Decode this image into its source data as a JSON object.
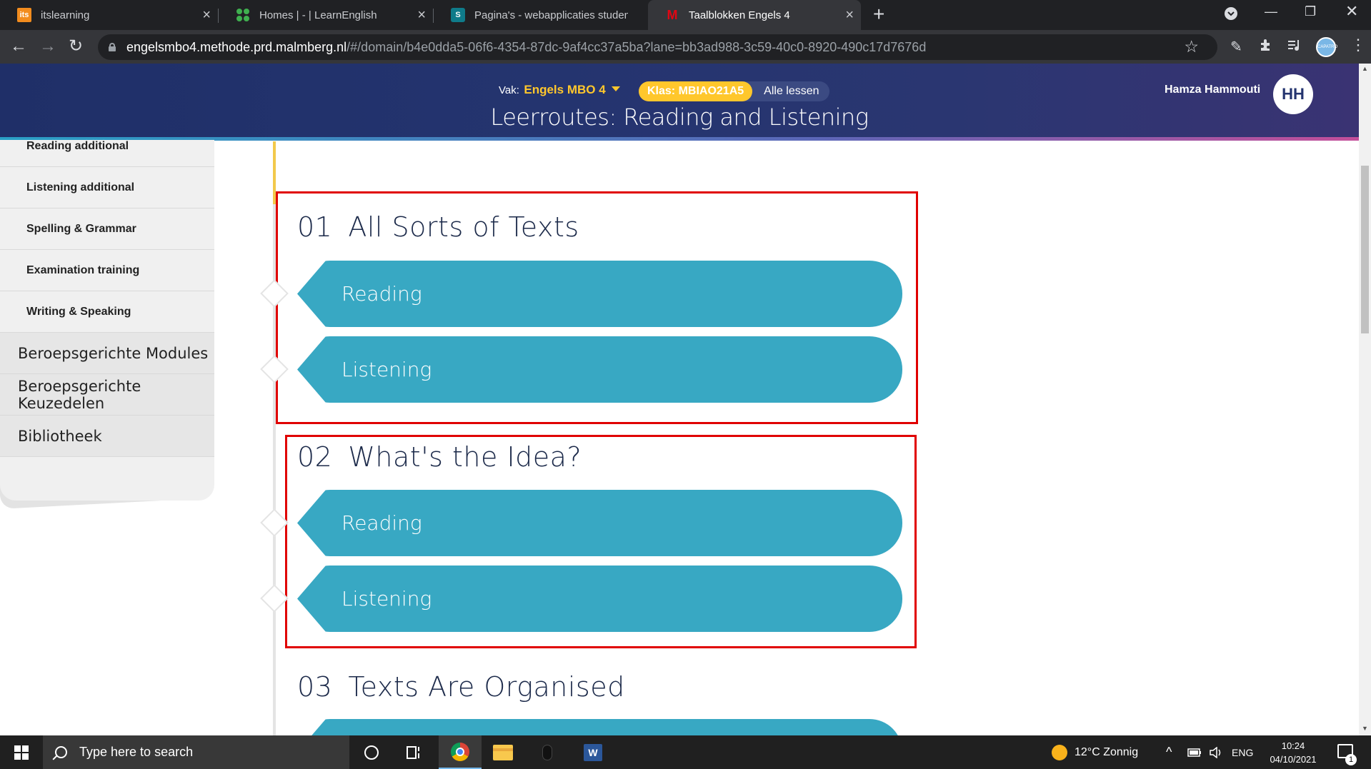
{
  "browser": {
    "tabs": [
      {
        "title": "itslearning",
        "favicon": "itslearning-icon",
        "favicon_text": "its"
      },
      {
        "title": "Homes | - | LearnEnglish",
        "favicon": "learnenglish-icon"
      },
      {
        "title": "Pagina's - webapplicaties student",
        "favicon": "sharepoint-icon",
        "favicon_text": "S"
      },
      {
        "title": "Taalblokken Engels 4",
        "favicon": "malmberg-icon",
        "favicon_text": "M"
      }
    ],
    "url_host": "engelsmbo4.methode.prd.malmberg.nl",
    "url_rest": "/#/domain/b4e0dda5-06f6-4354-87dc-9af4cc37a5ba?lane=bb3ad988-3c59-40c0-8920-490c17d7676d",
    "profile_text": "CAPATRO"
  },
  "header": {
    "vak_label": "Vak:",
    "vak_value": "Engels MBO 4",
    "klas_label": "Klas:",
    "klas_value": "MBIAO21A5",
    "alle_lessen": "Alle lessen",
    "title": "Leerroutes:  Reading and Listening",
    "user_name": "Hamza Hammouti",
    "user_initials": "HH"
  },
  "sidebar": {
    "items": [
      {
        "label": "Reading additional",
        "type": "sub"
      },
      {
        "label": "Listening additional",
        "type": "sub"
      },
      {
        "label": "Spelling & Grammar",
        "type": "sub"
      },
      {
        "label": "Examination training",
        "type": "sub"
      },
      {
        "label": "Writing & Speaking",
        "type": "sub"
      },
      {
        "label": "Beroepsgerichte Modules",
        "type": "main"
      },
      {
        "label": "Beroepsgerichte Keuzedelen",
        "type": "main"
      },
      {
        "label": "Bibliotheek",
        "type": "main"
      }
    ]
  },
  "sections": [
    {
      "number": "01",
      "title": "All Sorts of Texts",
      "items": [
        "Reading",
        "Listening"
      ]
    },
    {
      "number": "02",
      "title": "What's the Idea?",
      "items": [
        "Reading",
        "Listening"
      ]
    },
    {
      "number": "03",
      "title": "Texts Are Organised",
      "items": []
    }
  ],
  "colors": {
    "header_bg": "#24346f",
    "accent_yellow": "#ffc72c",
    "pill_blue": "#38a8c3",
    "highlight_red": "#e00000",
    "title_text": "#1c2a4a"
  },
  "taskbar": {
    "search_placeholder": "Type here to search",
    "weather": "12°C  Zonnig",
    "language": "ENG",
    "time": "10:24",
    "date": "04/10/2021",
    "notification_count": "1"
  }
}
